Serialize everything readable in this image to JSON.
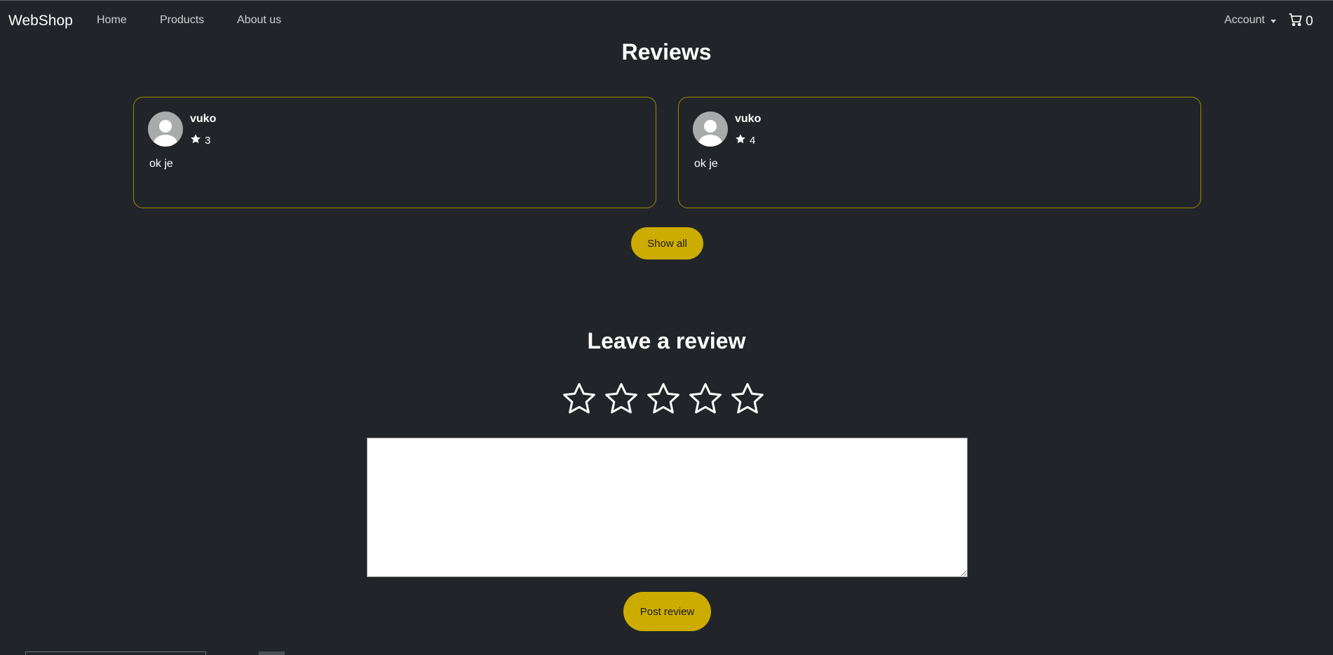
{
  "navbar": {
    "brand": "WebShop",
    "links": [
      "Home",
      "Products",
      "About us"
    ],
    "account_label": "Account",
    "cart_count": "0"
  },
  "reviews": {
    "title": "Reviews",
    "items": [
      {
        "name": "vuko",
        "rating": "3",
        "text": "ok je"
      },
      {
        "name": "vuko",
        "rating": "4",
        "text": "ok je"
      }
    ],
    "show_all_label": "Show all"
  },
  "leave_review": {
    "title": "Leave a review",
    "star_count": 5,
    "textarea_value": "",
    "post_label": "Post review"
  },
  "colors": {
    "background": "#212529",
    "accent": "#ccac00",
    "card_border": "#a08a00"
  }
}
